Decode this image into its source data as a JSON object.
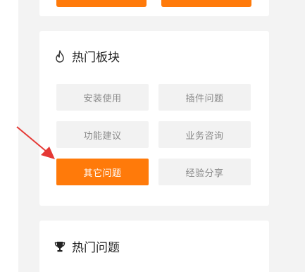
{
  "colors": {
    "accent": "#ff7a0a",
    "background": "#f3f3f3",
    "card": "#ffffff",
    "chip": "#f2f2f2",
    "annotation_arrow": "#e53935"
  },
  "hot_sections": {
    "title": "热门板块",
    "icon": "flame-outline-icon",
    "items": [
      {
        "label": "安装使用",
        "active": false
      },
      {
        "label": "插件问题",
        "active": false
      },
      {
        "label": "功能建议",
        "active": false
      },
      {
        "label": "业务咨询",
        "active": false
      },
      {
        "label": "其它问题",
        "active": true
      },
      {
        "label": "经验分享",
        "active": false
      }
    ]
  },
  "hot_questions": {
    "title": "热门问题",
    "icon": "trophy-icon"
  }
}
